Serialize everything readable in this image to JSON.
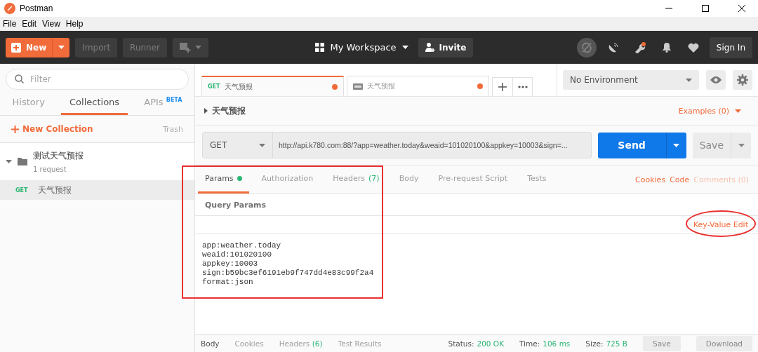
{
  "window": {
    "title": "Postman"
  },
  "menu": [
    "File",
    "Edit",
    "View",
    "Help"
  ],
  "toolbar": {
    "new_button": "New",
    "import_button": "Import",
    "runner_button": "Runner",
    "workspace": "My Workspace",
    "invite_button": "Invite",
    "sign_in_button": "Sign In"
  },
  "sidebar": {
    "filter": {
      "placeholder": "Filter"
    },
    "tabs": [
      {
        "label": "History",
        "selected": false
      },
      {
        "label": "Collections",
        "selected": true
      },
      {
        "label": "APIs",
        "badge": "BETA",
        "selected": false
      }
    ],
    "new_collection": "New Collection",
    "trash": "Trash",
    "collections": [
      {
        "name": "测试天气预报",
        "count": "1 request",
        "expanded": true,
        "requests": [
          {
            "method": "GET",
            "name": "天气预报",
            "selected": true
          }
        ]
      }
    ]
  },
  "request_tabs": [
    {
      "kind": "request",
      "method": "GET",
      "name": "天气预报",
      "selected": true,
      "unsaved": true
    },
    {
      "kind": "example",
      "name": "天气预报",
      "selected": false,
      "unsaved": true
    }
  ],
  "environment": {
    "value": "No Environment"
  },
  "request": {
    "name": "天气预报",
    "examples": "Examples (0)",
    "method": "GET",
    "url": "http://api.k780.com:88/?app=weather.today&weaid=101020100&appkey=10003&sign=...",
    "send_button": "Send",
    "save_button": "Save"
  },
  "request_sections": {
    "tabs": [
      {
        "label": "Params",
        "dot": true,
        "selected": true
      },
      {
        "label": "Authorization",
        "dot": false,
        "selected": false
      },
      {
        "label": "Headers",
        "count": "(7)",
        "dot": false,
        "selected": false
      },
      {
        "label": "Body",
        "dot": false,
        "selected": false
      },
      {
        "label": "Pre-request Script",
        "dot": false,
        "selected": false
      },
      {
        "label": "Tests",
        "dot": false,
        "selected": false
      }
    ],
    "links": [
      {
        "label": "Cookies",
        "disabled": false
      },
      {
        "label": "Code",
        "disabled": false
      },
      {
        "label": "Comments (0)",
        "disabled": true
      }
    ]
  },
  "query_params": {
    "title": "Query Params",
    "mode_link": "Key-Value Edit",
    "bulk_lines": [
      "app:weather.today",
      "weaid:101020100",
      "appkey:10003",
      "sign:b59bc3ef6191eb9f747dd4e83c99f2a4",
      "format:json"
    ]
  },
  "response": {
    "tabs": [
      {
        "label": "Body",
        "selected": true
      },
      {
        "label": "Cookies",
        "selected": false
      },
      {
        "label": "Headers",
        "count": "(6)",
        "selected": false
      },
      {
        "label": "Test Results",
        "selected": false
      }
    ],
    "stats": [
      {
        "label": "Status:",
        "value": "200 OK"
      },
      {
        "label": "Time:",
        "value": "106 ms"
      },
      {
        "label": "Size:",
        "value": "725 B"
      }
    ],
    "save_button": "Save",
    "download_button": "Download"
  },
  "annotations": [
    {
      "kind": "rectangle"
    },
    {
      "kind": "ellipse"
    }
  ]
}
